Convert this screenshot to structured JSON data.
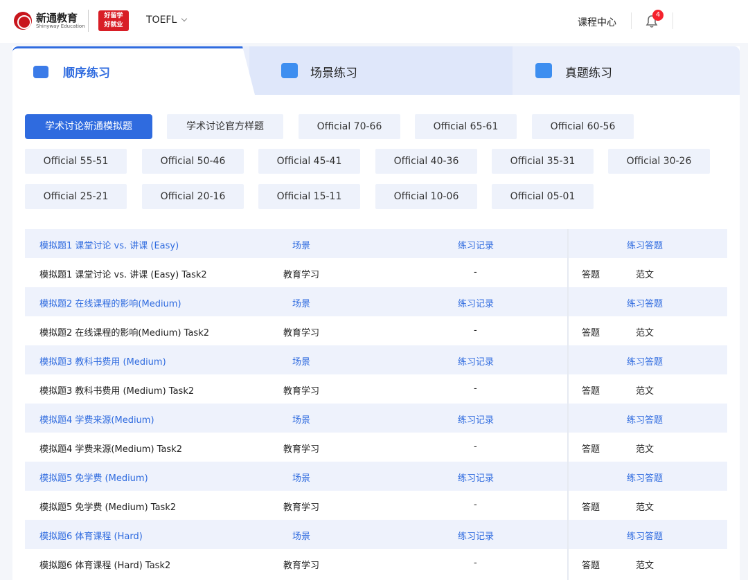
{
  "header": {
    "brand": "新通教育",
    "brand_sub": "Shinyway Education",
    "badge_line1": "好留学",
    "badge_line2": "好就业",
    "exam": "TOEFL",
    "course_center": "课程中心",
    "notification_count": "4"
  },
  "tabs": [
    {
      "label": "顺序练习",
      "active": true,
      "icon": "list-icon"
    },
    {
      "label": "场景练习",
      "active": false,
      "icon": "monitor-icon"
    },
    {
      "label": "真题练习",
      "active": false,
      "icon": "folder-icon"
    }
  ],
  "categories": [
    "学术讨论新通模拟题",
    "学术讨论官方样题",
    "Official 70-66",
    "Official 65-61",
    "Official 60-56",
    "Official 55-51",
    "Official 50-46",
    "Official 45-41",
    "Official 40-36",
    "Official 35-31",
    "Official 30-26",
    "Official 25-21",
    "Official 20-16",
    "Official 15-11",
    "Official 10-06",
    "Official 05-01"
  ],
  "table": {
    "col_scene": "场景",
    "col_record": "练习记录",
    "col_action": "练习答题",
    "groups": [
      {
        "title": "模拟题1 课堂讨论 vs. 讲课 (Easy)",
        "task": "模拟题1 课堂讨论 vs. 讲课 (Easy) Task2",
        "scene": "教育学习",
        "record": "-",
        "answer": "答题",
        "sample": "范文"
      },
      {
        "title": "模拟题2 在线课程的影响(Medium)",
        "task": "模拟题2 在线课程的影响(Medium) Task2",
        "scene": "教育学习",
        "record": "-",
        "answer": "答题",
        "sample": "范文"
      },
      {
        "title": "模拟题3 教科书费用 (Medium)",
        "task": "模拟题3 教科书费用 (Medium) Task2",
        "scene": "教育学习",
        "record": "-",
        "answer": "答题",
        "sample": "范文"
      },
      {
        "title": "模拟题4 学费来源(Medium)",
        "task": "模拟题4 学费来源(Medium) Task2",
        "scene": "教育学习",
        "record": "-",
        "answer": "答题",
        "sample": "范文"
      },
      {
        "title": "模拟题5 免学费 (Medium)",
        "task": "模拟题5 免学费 (Medium) Task2",
        "scene": "教育学习",
        "record": "-",
        "answer": "答题",
        "sample": "范文"
      },
      {
        "title": "模拟题6 体育课程 (Hard)",
        "task": "模拟题6 体育课程 (Hard) Task2",
        "scene": "教育学习",
        "record": "-",
        "answer": "答题",
        "sample": "范文"
      }
    ]
  },
  "colors": {
    "accent": "#2f6bdf",
    "brand_red": "#c8161d",
    "head_row": "#eef2fc"
  }
}
